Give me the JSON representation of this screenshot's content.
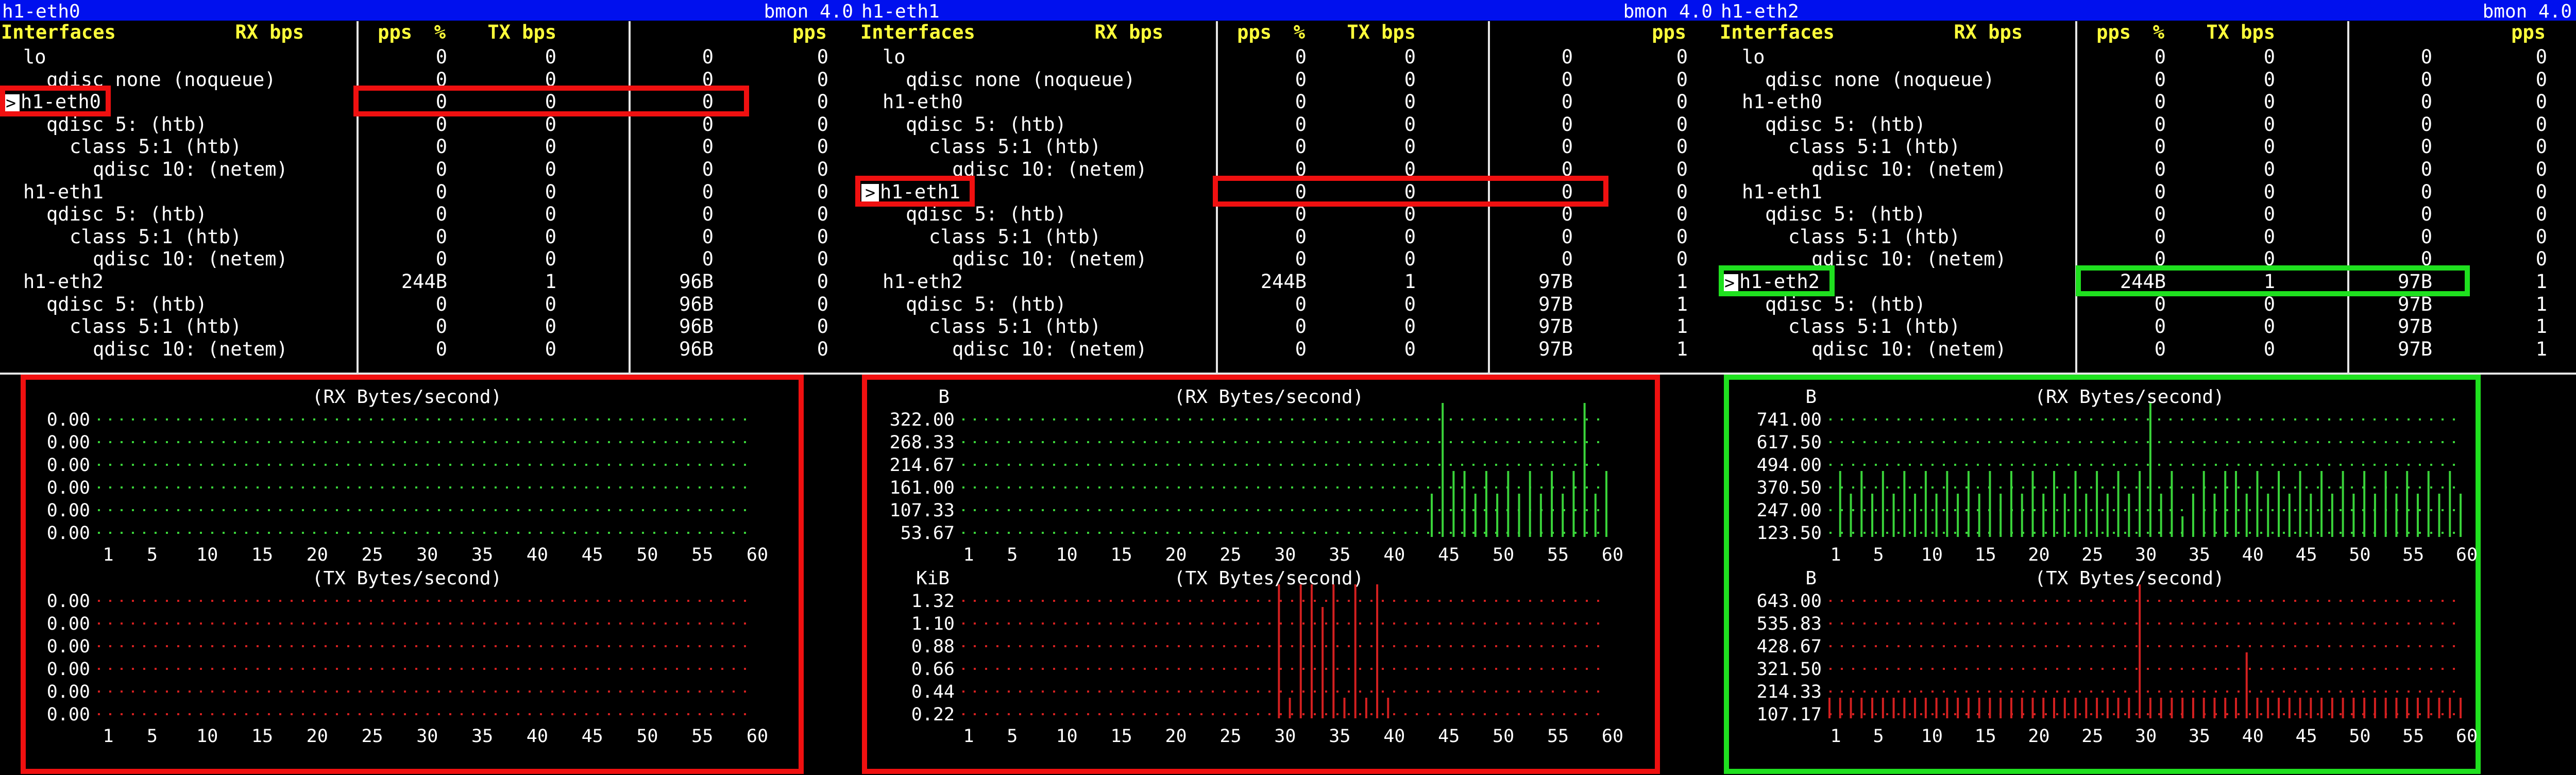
{
  "panes": [
    {
      "title": "h1-eth0",
      "version": "bmon 4.0",
      "selected_row": 2,
      "highlight": "red",
      "stats_box": [
        5
      ],
      "headers": {
        "interfaces": "Interfaces",
        "rx_bps": "RX bps",
        "pps": "pps",
        "pct": "%",
        "tx_bps": "TX bps",
        "tx_pps": "pps"
      },
      "rows": [
        {
          "indent": 1,
          "name": "lo",
          "rx": "0",
          "rxp": "0",
          "tx": "0",
          "txp": "0"
        },
        {
          "indent": 2,
          "name": "qdisc none (noqueue)",
          "rx": "0",
          "rxp": "0",
          "tx": "0",
          "txp": "0"
        },
        {
          "indent": 0,
          "name": "h1-eth0",
          "rx": "0",
          "rxp": "0",
          "tx": "0",
          "txp": "0"
        },
        {
          "indent": 2,
          "name": "qdisc 5: (htb)",
          "rx": "0",
          "rxp": "0",
          "tx": "0",
          "txp": "0"
        },
        {
          "indent": 3,
          "name": "class 5:1 (htb)",
          "rx": "0",
          "rxp": "0",
          "tx": "0",
          "txp": "0"
        },
        {
          "indent": 4,
          "name": "qdisc 10: (netem)",
          "rx": "0",
          "rxp": "0",
          "tx": "0",
          "txp": "0"
        },
        {
          "indent": 1,
          "name": "h1-eth1",
          "rx": "0",
          "rxp": "0",
          "tx": "0",
          "txp": "0"
        },
        {
          "indent": 2,
          "name": "qdisc 5: (htb)",
          "rx": "0",
          "rxp": "0",
          "tx": "0",
          "txp": "0"
        },
        {
          "indent": 3,
          "name": "class 5:1 (htb)",
          "rx": "0",
          "rxp": "0",
          "tx": "0",
          "txp": "0"
        },
        {
          "indent": 4,
          "name": "qdisc 10: (netem)",
          "rx": "0",
          "rxp": "0",
          "tx": "0",
          "txp": "0"
        },
        {
          "indent": 1,
          "name": "h1-eth2",
          "rx": "244B",
          "rxp": "1",
          "tx": "96B",
          "txp": "0"
        },
        {
          "indent": 2,
          "name": "qdisc 5: (htb)",
          "rx": "0",
          "rxp": "0",
          "tx": "96B",
          "txp": "0"
        },
        {
          "indent": 3,
          "name": "class 5:1 (htb)",
          "rx": "0",
          "rxp": "0",
          "tx": "96B",
          "txp": "0"
        },
        {
          "indent": 4,
          "name": "qdisc 10: (netem)",
          "rx": "0",
          "rxp": "0",
          "tx": "96B",
          "txp": "0"
        }
      ],
      "graphs": [
        {
          "title": "(RX Bytes/second)",
          "unit": "",
          "labels": [
            "0.00",
            "0.00",
            "0.00",
            "0.00",
            "0.00",
            "0.00"
          ],
          "color": "#3ad43a",
          "bars": [
            0,
            0,
            0,
            0,
            0,
            0,
            0,
            0,
            0,
            0,
            0,
            0,
            0,
            0,
            0,
            0,
            0,
            0,
            0,
            0,
            0,
            0,
            0,
            0,
            0,
            0,
            0,
            0,
            0,
            0,
            0,
            0,
            0,
            0,
            0,
            0,
            0,
            0,
            0,
            0,
            0,
            0,
            0,
            0,
            0,
            0,
            0,
            0,
            0,
            0,
            0,
            0,
            0,
            0,
            0,
            0,
            0,
            0,
            0,
            0
          ]
        },
        {
          "title": "(TX Bytes/second)",
          "unit": "",
          "labels": [
            "0.00",
            "0.00",
            "0.00",
            "0.00",
            "0.00",
            "0.00"
          ],
          "color": "#d42020",
          "bars": [
            0,
            0,
            0,
            0,
            0,
            0,
            0,
            0,
            0,
            0,
            0,
            0,
            0,
            0,
            0,
            0,
            0,
            0,
            0,
            0,
            0,
            0,
            0,
            0,
            0,
            0,
            0,
            0,
            0,
            0,
            0,
            0,
            0,
            0,
            0,
            0,
            0,
            0,
            0,
            0,
            0,
            0,
            0,
            0,
            0,
            0,
            0,
            0,
            0,
            0,
            0,
            0,
            0,
            0,
            0,
            0,
            0,
            0,
            0,
            0
          ]
        }
      ],
      "xticks": [
        "1",
        "5",
        "10",
        "15",
        "20",
        "25",
        "30",
        "35",
        "40",
        "45",
        "50",
        "55",
        "60"
      ]
    },
    {
      "title": "h1-eth1",
      "version": "bmon 4.0",
      "selected_row": 6,
      "highlight": "red",
      "stats_box": [
        6
      ],
      "headers": {
        "interfaces": "Interfaces",
        "rx_bps": "RX bps",
        "pps": "pps",
        "pct": "%",
        "tx_bps": "TX bps",
        "tx_pps": "pps"
      },
      "rows": [
        {
          "indent": 1,
          "name": "lo",
          "rx": "0",
          "rxp": "0",
          "tx": "0",
          "txp": "0"
        },
        {
          "indent": 2,
          "name": "qdisc none (noqueue)",
          "rx": "0",
          "rxp": "0",
          "tx": "0",
          "txp": "0"
        },
        {
          "indent": 1,
          "name": "h1-eth0",
          "rx": "0",
          "rxp": "0",
          "tx": "0",
          "txp": "0"
        },
        {
          "indent": 2,
          "name": "qdisc 5: (htb)",
          "rx": "0",
          "rxp": "0",
          "tx": "0",
          "txp": "0"
        },
        {
          "indent": 3,
          "name": "class 5:1 (htb)",
          "rx": "0",
          "rxp": "0",
          "tx": "0",
          "txp": "0"
        },
        {
          "indent": 4,
          "name": "qdisc 10: (netem)",
          "rx": "0",
          "rxp": "0",
          "tx": "0",
          "txp": "0"
        },
        {
          "indent": 0,
          "name": "h1-eth1",
          "rx": "0",
          "rxp": "0",
          "tx": "0",
          "txp": "0"
        },
        {
          "indent": 2,
          "name": "qdisc 5: (htb)",
          "rx": "0",
          "rxp": "0",
          "tx": "0",
          "txp": "0"
        },
        {
          "indent": 3,
          "name": "class 5:1 (htb)",
          "rx": "0",
          "rxp": "0",
          "tx": "0",
          "txp": "0"
        },
        {
          "indent": 4,
          "name": "qdisc 10: (netem)",
          "rx": "0",
          "rxp": "0",
          "tx": "0",
          "txp": "0"
        },
        {
          "indent": 1,
          "name": "h1-eth2",
          "rx": "244B",
          "rxp": "1",
          "tx": "97B",
          "txp": "1"
        },
        {
          "indent": 2,
          "name": "qdisc 5: (htb)",
          "rx": "0",
          "rxp": "0",
          "tx": "97B",
          "txp": "1"
        },
        {
          "indent": 3,
          "name": "class 5:1 (htb)",
          "rx": "0",
          "rxp": "0",
          "tx": "97B",
          "txp": "1"
        },
        {
          "indent": 4,
          "name": "qdisc 10: (netem)",
          "rx": "0",
          "rxp": "0",
          "tx": "97B",
          "txp": "1"
        }
      ],
      "graphs": [
        {
          "title": "(RX Bytes/second)",
          "unit": "B",
          "labels": [
            "322.00",
            "268.33",
            "214.67",
            "161.00",
            "107.33",
            "53.67"
          ],
          "color": "#3ad43a",
          "bars": [
            0,
            0,
            0,
            0,
            0,
            0,
            0,
            0,
            0,
            0,
            0,
            0,
            0,
            0,
            0,
            0,
            0,
            0,
            0,
            0,
            0,
            0,
            0,
            0,
            0,
            0,
            0,
            0,
            0,
            0,
            0,
            0,
            0,
            0,
            0,
            0,
            0,
            0,
            0,
            0,
            0,
            0,
            0,
            2,
            6,
            3,
            3,
            2,
            3,
            2,
            3,
            2,
            3,
            2,
            3,
            2,
            3,
            6,
            2,
            3
          ]
        },
        {
          "title": "(TX Bytes/second)",
          "unit": "KiB",
          "labels": [
            "1.32",
            "1.10",
            "0.88",
            "0.66",
            "0.44",
            "0.22"
          ],
          "color": "#d42020",
          "bars": [
            0,
            0,
            0,
            0,
            0,
            0,
            0,
            0,
            0,
            0,
            0,
            0,
            0,
            0,
            0,
            0,
            0,
            0,
            0,
            0,
            0,
            0,
            0,
            0,
            0,
            0,
            0,
            0,
            0,
            6,
            1,
            6,
            6,
            5,
            6,
            1,
            6,
            1,
            6,
            1,
            0,
            0,
            0,
            0,
            0,
            0,
            0,
            0,
            0,
            0,
            0,
            0,
            0,
            0,
            0,
            0,
            0,
            0,
            0,
            0
          ]
        }
      ],
      "xticks": [
        "1",
        "5",
        "10",
        "15",
        "20",
        "25",
        "30",
        "35",
        "40",
        "45",
        "50",
        "55",
        "60"
      ]
    },
    {
      "title": "h1-eth2",
      "version": "bmon 4.0",
      "selected_row": 10,
      "highlight": "green",
      "stats_box": [
        10
      ],
      "headers": {
        "interfaces": "Interfaces",
        "rx_bps": "RX bps",
        "pps": "pps",
        "pct": "%",
        "tx_bps": "TX bps",
        "tx_pps": "pps"
      },
      "rows": [
        {
          "indent": 1,
          "name": "lo",
          "rx": "0",
          "rxp": "0",
          "tx": "0",
          "txp": "0"
        },
        {
          "indent": 2,
          "name": "qdisc none (noqueue)",
          "rx": "0",
          "rxp": "0",
          "tx": "0",
          "txp": "0"
        },
        {
          "indent": 1,
          "name": "h1-eth0",
          "rx": "0",
          "rxp": "0",
          "tx": "0",
          "txp": "0"
        },
        {
          "indent": 2,
          "name": "qdisc 5: (htb)",
          "rx": "0",
          "rxp": "0",
          "tx": "0",
          "txp": "0"
        },
        {
          "indent": 3,
          "name": "class 5:1 (htb)",
          "rx": "0",
          "rxp": "0",
          "tx": "0",
          "txp": "0"
        },
        {
          "indent": 4,
          "name": "qdisc 10: (netem)",
          "rx": "0",
          "rxp": "0",
          "tx": "0",
          "txp": "0"
        },
        {
          "indent": 1,
          "name": "h1-eth1",
          "rx": "0",
          "rxp": "0",
          "tx": "0",
          "txp": "0"
        },
        {
          "indent": 2,
          "name": "qdisc 5: (htb)",
          "rx": "0",
          "rxp": "0",
          "tx": "0",
          "txp": "0"
        },
        {
          "indent": 3,
          "name": "class 5:1 (htb)",
          "rx": "0",
          "rxp": "0",
          "tx": "0",
          "txp": "0"
        },
        {
          "indent": 4,
          "name": "qdisc 10: (netem)",
          "rx": "0",
          "rxp": "0",
          "tx": "0",
          "txp": "0"
        },
        {
          "indent": 0,
          "name": "h1-eth2",
          "rx": "244B",
          "rxp": "1",
          "tx": "97B",
          "txp": "1"
        },
        {
          "indent": 2,
          "name": "qdisc 5: (htb)",
          "rx": "0",
          "rxp": "0",
          "tx": "97B",
          "txp": "1"
        },
        {
          "indent": 3,
          "name": "class 5:1 (htb)",
          "rx": "0",
          "rxp": "0",
          "tx": "97B",
          "txp": "1"
        },
        {
          "indent": 4,
          "name": "qdisc 10: (netem)",
          "rx": "0",
          "rxp": "0",
          "tx": "97B",
          "txp": "1"
        }
      ],
      "graphs": [
        {
          "title": "(RX Bytes/second)",
          "unit": "B",
          "labels": [
            "741.00",
            "617.50",
            "494.00",
            "370.50",
            "247.00",
            "123.50"
          ],
          "color": "#3ad43a",
          "bars": [
            0,
            3,
            2,
            3,
            2,
            3,
            2,
            3,
            2,
            3,
            2,
            3,
            2,
            3,
            2,
            3,
            2,
            3,
            2,
            3,
            2,
            3,
            2,
            3,
            2,
            3,
            2,
            3,
            2,
            3,
            6,
            2,
            3,
            1,
            2,
            3,
            2,
            3,
            3,
            2,
            3,
            2,
            3,
            2,
            3,
            2,
            3,
            2,
            3,
            2,
            3,
            2,
            3,
            2,
            3,
            2,
            3,
            2,
            3,
            2
          ]
        },
        {
          "title": "(TX Bytes/second)",
          "unit": "B",
          "labels": [
            "643.00",
            "535.83",
            "428.67",
            "321.50",
            "214.33",
            "107.17"
          ],
          "color": "#d42020",
          "bars": [
            1,
            1,
            1,
            1,
            1,
            1,
            1,
            1,
            1,
            1,
            1,
            1,
            1,
            1,
            1,
            1,
            1,
            1,
            1,
            1,
            1,
            1,
            1,
            1,
            1,
            1,
            1,
            1,
            1,
            6,
            1,
            1,
            1,
            1,
            1,
            1,
            1,
            1,
            1,
            3,
            1,
            1,
            1,
            1,
            1,
            1,
            1,
            1,
            1,
            1,
            1,
            1,
            1,
            1,
            1,
            1,
            1,
            1,
            1,
            1
          ]
        }
      ],
      "xticks": [
        "1",
        "5",
        "10",
        "15",
        "20",
        "25",
        "30",
        "35",
        "40",
        "45",
        "50",
        "55",
        "60"
      ]
    }
  ]
}
